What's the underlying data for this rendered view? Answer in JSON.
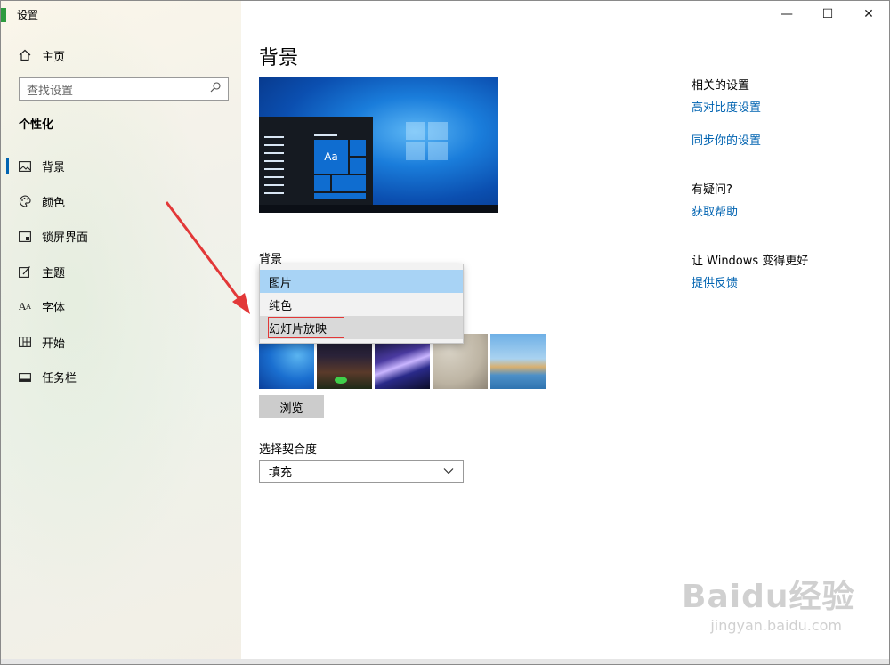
{
  "window": {
    "title": "设置",
    "controls": {
      "minimize": "—",
      "maximize": "☐",
      "close": "✕"
    }
  },
  "sidebar": {
    "home_label": "主页",
    "search_placeholder": "查找设置",
    "section_header": "个性化",
    "items": [
      {
        "label": "背景",
        "icon": "image-icon",
        "active": true
      },
      {
        "label": "颜色",
        "icon": "palette-icon",
        "active": false
      },
      {
        "label": "锁屏界面",
        "icon": "lockscreen-icon",
        "active": false
      },
      {
        "label": "主题",
        "icon": "theme-icon",
        "active": false
      },
      {
        "label": "字体",
        "icon": "font-icon",
        "active": false
      },
      {
        "label": "开始",
        "icon": "start-icon",
        "active": false
      },
      {
        "label": "任务栏",
        "icon": "taskbar-icon",
        "active": false
      }
    ]
  },
  "main": {
    "title": "背景",
    "preview": {
      "tile_text": "Aa"
    },
    "background_label": "背景",
    "dropdown_options": [
      {
        "label": "图片",
        "state": "selected"
      },
      {
        "label": "纯色",
        "state": "normal"
      },
      {
        "label": "幻灯片放映",
        "state": "hover"
      }
    ],
    "browse_label": "浏览",
    "fit_label": "选择契合度",
    "fit_value": "填充"
  },
  "related": {
    "header": "相关的设置",
    "links": [
      "高对比度设置",
      "同步你的设置"
    ],
    "question_header": "有疑问?",
    "help_link": "获取帮助",
    "improve_header": "让 Windows 变得更好",
    "feedback_link": "提供反馈"
  },
  "watermark": {
    "brand": "Baidu经验",
    "url": "jingyan.baidu.com"
  },
  "colors": {
    "accent": "#0063b1",
    "annotation_red": "#e23838",
    "dropdown_selected": "#a8d3f5"
  }
}
